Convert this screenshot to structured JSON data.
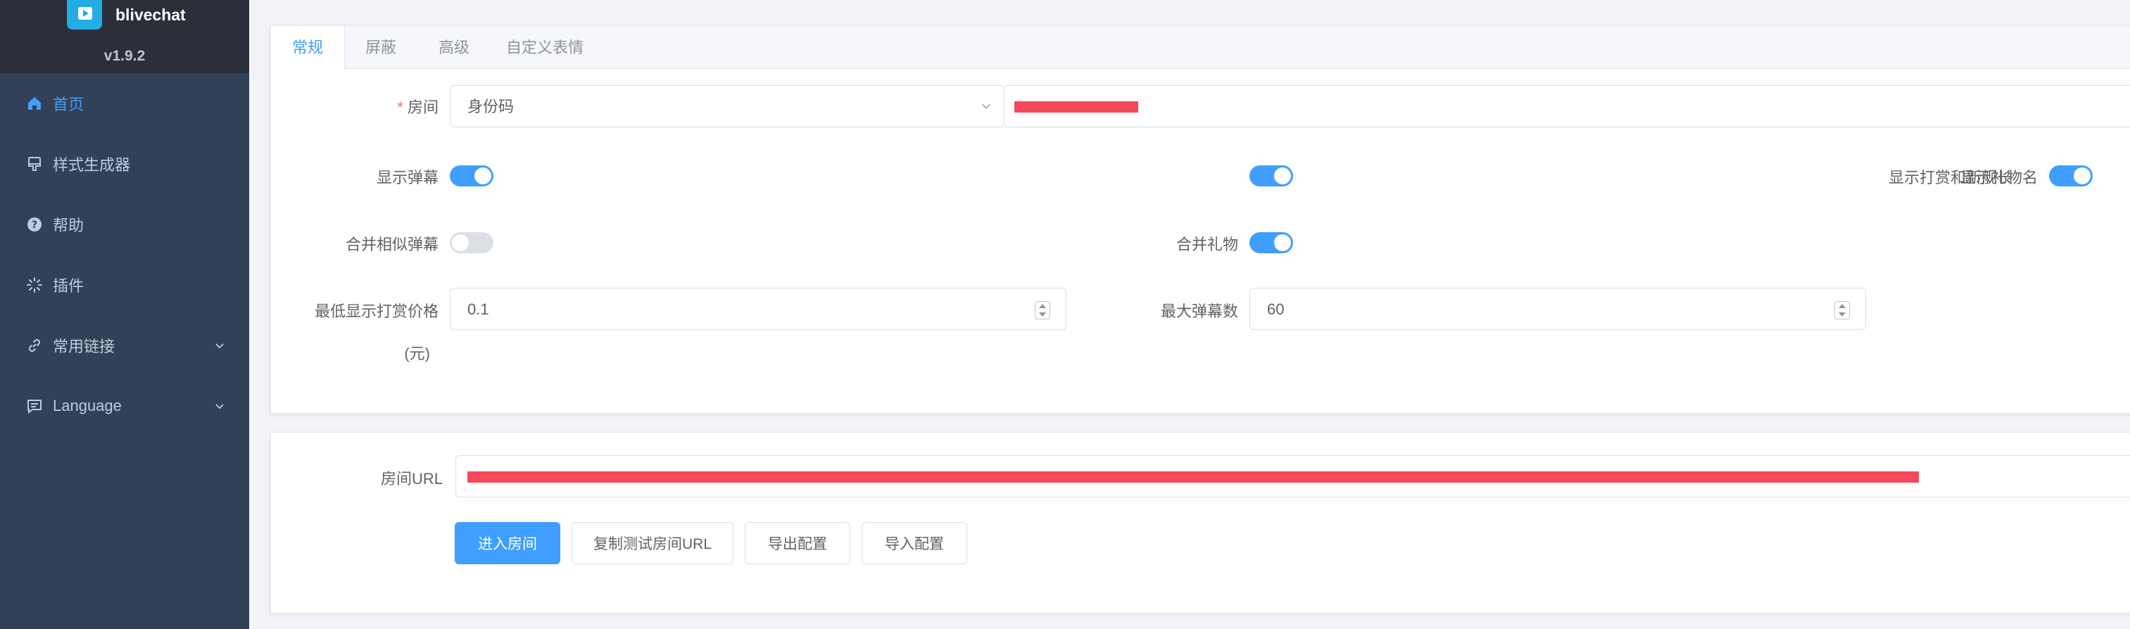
{
  "app": {
    "name": "blivechat",
    "version": "v1.9.2"
  },
  "sidebar": {
    "items": [
      {
        "label": "首页",
        "icon": "home-icon",
        "active": true
      },
      {
        "label": "样式生成器",
        "icon": "brush-icon"
      },
      {
        "label": "帮助",
        "icon": "question-icon"
      },
      {
        "label": "插件",
        "icon": "plugin-icon"
      },
      {
        "label": "常用链接",
        "icon": "link-icon",
        "expandable": true
      },
      {
        "label": "Language",
        "icon": "chat-icon",
        "expandable": true
      }
    ]
  },
  "tabs": [
    {
      "label": "常规",
      "active": true
    },
    {
      "label": "屏蔽"
    },
    {
      "label": "高级"
    },
    {
      "label": "自定义表情"
    }
  ],
  "form": {
    "room_required_mark": "*",
    "room_label": "房间",
    "room_type_value": "身份码",
    "show_danmaku_label": "显示弹幕",
    "show_danmaku": true,
    "show_gift_label": "显示打赏和新舰长",
    "show_gift": true,
    "show_gift_name_label": "显示礼物名",
    "show_gift_name": true,
    "merge_similar_label": "合并相似弹幕",
    "merge_similar": false,
    "merge_gift_label": "合并礼物",
    "merge_gift": true,
    "min_price_label_line1": "最低显示打赏价格",
    "min_price_label_line2": "(元)",
    "min_price_value": "0.1",
    "max_danmaku_label": "最大弹幕数",
    "max_danmaku_value": "60"
  },
  "room_url": {
    "label": "房间URL"
  },
  "buttons": {
    "enter_room": "进入房间",
    "copy_test_url": "复制测试房间URL",
    "export_config": "导出配置",
    "import_config": "导入配置"
  },
  "colors": {
    "primary": "#409eff",
    "sidebar_bg": "#324157",
    "brand_bg": "#2b2f3a",
    "redaction": "#f5485a"
  }
}
